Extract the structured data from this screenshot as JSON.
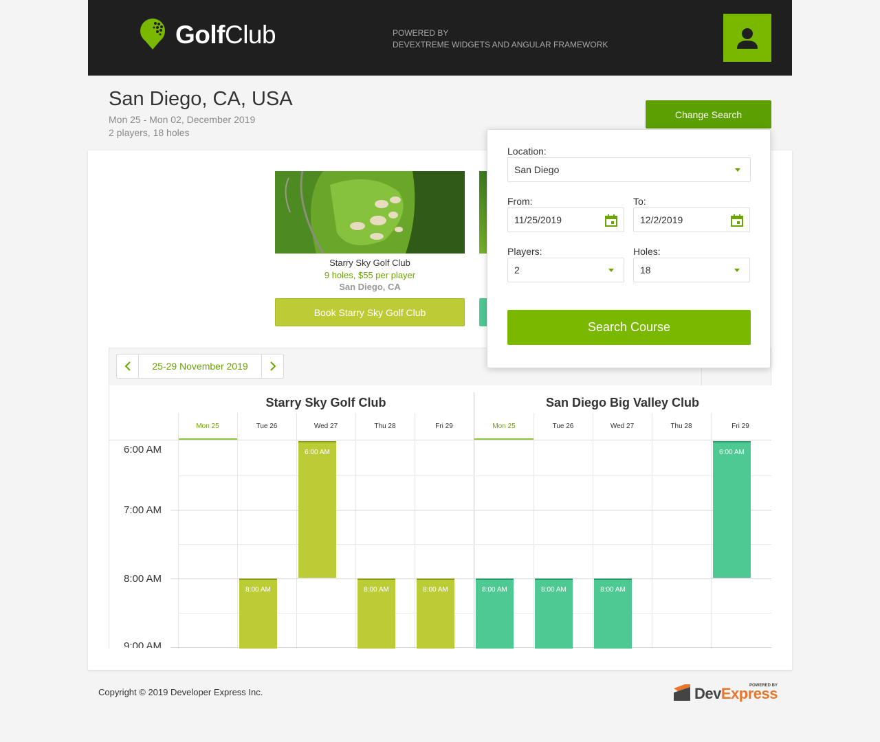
{
  "header": {
    "brand_bold": "Golf",
    "brand_light": "Club",
    "powered_line1": "POWERED BY",
    "powered_line2": "DEVEXTREME WIDGETS AND ANGULAR FRAMEWORK",
    "accent_color": "#7ab800"
  },
  "search_summary": {
    "title": "San Diego, CA, USA",
    "dates": "Mon 25 - Mon 02, December 2019",
    "details": "2 players, 18 holes",
    "change_label": "Change Search"
  },
  "courses": [
    {
      "name": "Starry Sky Golf Club",
      "price": "9 holes, $55 per player",
      "location": "San Diego, CA",
      "book_label": "Book Starry Sky Golf Club"
    }
  ],
  "search_popup": {
    "location_label": "Location:",
    "location_value": "San Diego",
    "from_label": "From:",
    "from_value": "11/25/2019",
    "to_label": "To:",
    "to_value": "12/2/2019",
    "players_label": "Players:",
    "players_value": "2",
    "holes_label": "Holes:",
    "holes_value": "18",
    "search_label": "Search Course"
  },
  "scheduler": {
    "range_label": "25-29 November 2019",
    "groups": [
      "Starry Sky Golf Club",
      "San Diego Big Valley Club"
    ],
    "days": [
      "Mon 25",
      "Tue 26",
      "Wed 27",
      "Thu 28",
      "Fri 29"
    ],
    "times": [
      "6:00 AM",
      "7:00 AM",
      "8:00 AM",
      "9:00 AM"
    ],
    "appointment_label_6": "6:00 AM",
    "appointment_label_8": "8:00 AM",
    "colors": {
      "group1": "#bccc37",
      "group2": "#4ec994"
    }
  },
  "footer": {
    "copyright": "Copyright © 2019 Developer Express Inc.",
    "dx_dev": "Dev",
    "dx_express": "Express",
    "dx_powered": "POWERED BY"
  }
}
